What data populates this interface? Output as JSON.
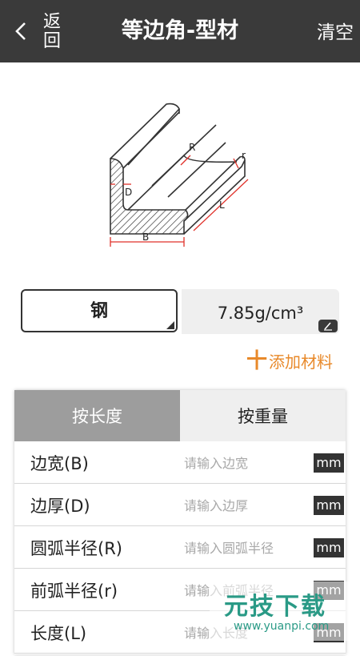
{
  "header": {
    "back_label": "返回",
    "title": "等边角-型材",
    "clear_label": "清空"
  },
  "diagram": {
    "labels": {
      "R": "R",
      "r": "r",
      "D": "D",
      "B": "B",
      "L": "L"
    },
    "accent_color": "#e0312a"
  },
  "material": {
    "name": "钢",
    "density": "7.85g/cm³",
    "add_label": "添加材料",
    "add_symbol": "十"
  },
  "tabs": [
    {
      "label": "按长度",
      "active": true
    },
    {
      "label": "按重量",
      "active": false
    }
  ],
  "fields": [
    {
      "label": "边宽(B)",
      "placeholder": "请输入边宽",
      "unit": "mm",
      "value": ""
    },
    {
      "label": "边厚(D)",
      "placeholder": "请输入边厚",
      "unit": "mm",
      "value": ""
    },
    {
      "label": "圆弧半径(R)",
      "placeholder": "请输入圆弧半径",
      "unit": "mm",
      "value": ""
    },
    {
      "label": "前弧半径(r)",
      "placeholder": "请输入前弧半径",
      "unit": "mm",
      "value": ""
    },
    {
      "label": "长度(L)",
      "placeholder": "请输入长度",
      "unit": "mm",
      "value": ""
    }
  ],
  "watermark": {
    "title": "元技下载",
    "url": "www.yuanpi.com"
  }
}
